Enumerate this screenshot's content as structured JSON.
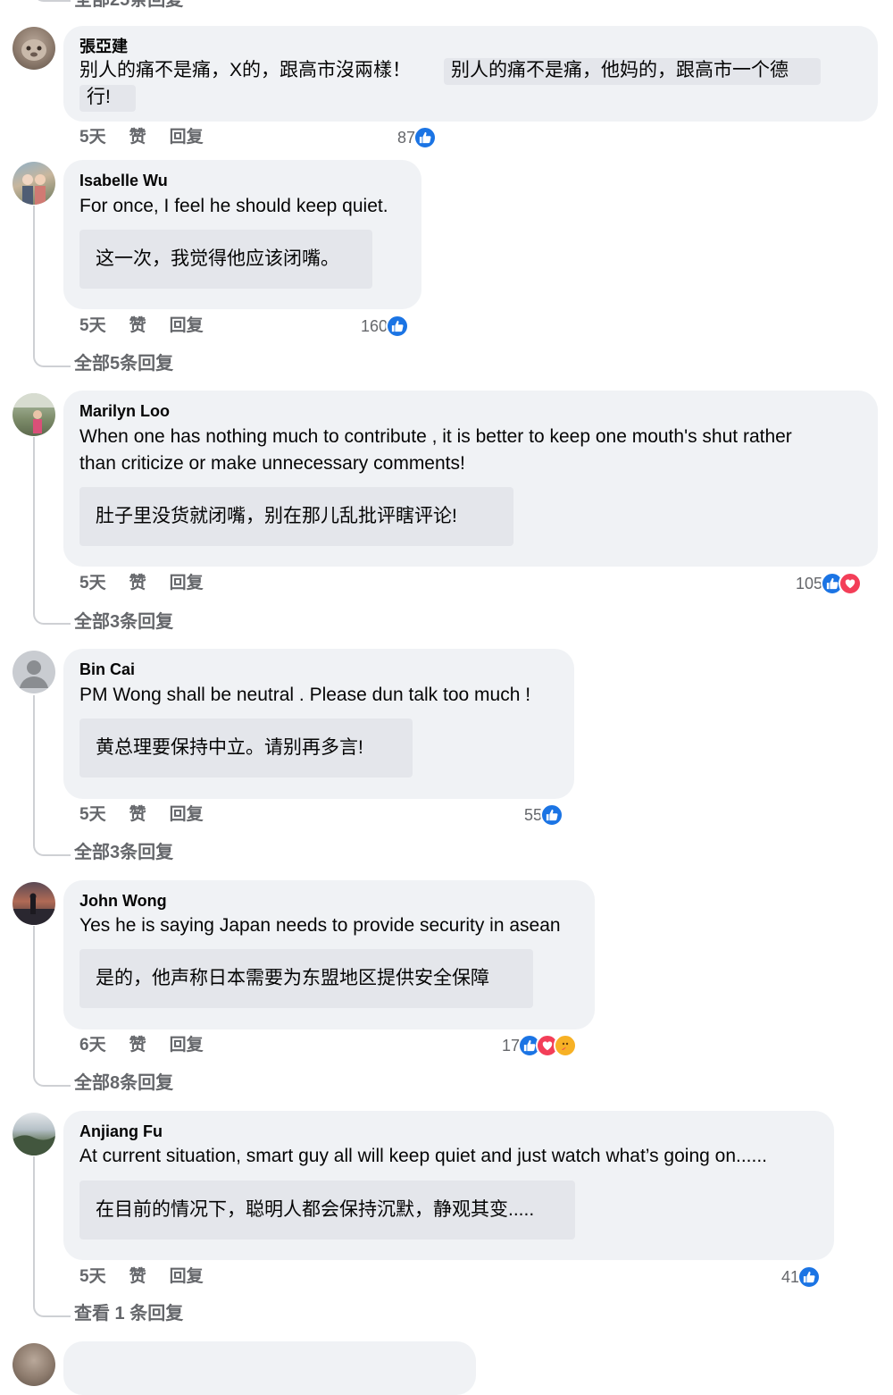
{
  "top_more": {
    "label": "全部25条回复"
  },
  "actions": {
    "like": "赞",
    "reply": "回复"
  },
  "comments": [
    {
      "author": "張亞建",
      "text_line1": "别人的痛不是痛，X的，跟高市沒兩樣！",
      "trans_line1": "别人的痛不是痛，他妈的，跟高市一个德",
      "trans_line2": "行!",
      "time": "5天",
      "count": "87",
      "reactions": [
        "like-icon"
      ]
    },
    {
      "author": "Isabelle Wu",
      "text_line1": "For once, I feel he should keep quiet.",
      "translation": "这一次，我觉得他应该闭嘴。",
      "time": "5天",
      "count": "160",
      "reactions": [
        "like-icon"
      ],
      "more": "全部5条回复"
    },
    {
      "author": "Marilyn Loo",
      "text_line1": "When one has nothing much to contribute , it is better to keep one mouth's shut rather",
      "text_line2": "than criticize or make unnecessary comments!",
      "translation": "肚子里没货就闭嘴，别在那儿乱批评瞎评论!",
      "time": "5天",
      "count": "105",
      "reactions": [
        "like-icon",
        "love-icon"
      ],
      "more": "全部3条回复"
    },
    {
      "author": "Bin Cai",
      "text_line1": "PM Wong shall be neutral . Please dun talk too much !",
      "translation": "黄总理要保持中立。请别再多言!",
      "time": "5天",
      "count": "55",
      "reactions": [
        "like-icon"
      ],
      "more": "全部3条回复"
    },
    {
      "author": "John Wong",
      "text_line1": "Yes he is saying Japan needs to provide security in asean",
      "translation": "是的，他声称日本需要为东盟地区提供安全保障",
      "time": "6天",
      "count": "17",
      "reactions": [
        "like-icon",
        "love-icon",
        "care-icon"
      ],
      "more": "全部8条回复"
    },
    {
      "author": "Anjiang Fu",
      "text_line1": "At current situation, smart guy all will keep quiet and just watch what’s going on......",
      "translation": "在目前的情况下，聪明人都会保持沉默，静观其变.....",
      "time": "5天",
      "count": "41",
      "reactions": [
        "like-icon"
      ],
      "more": "查看 1 条回复"
    }
  ]
}
